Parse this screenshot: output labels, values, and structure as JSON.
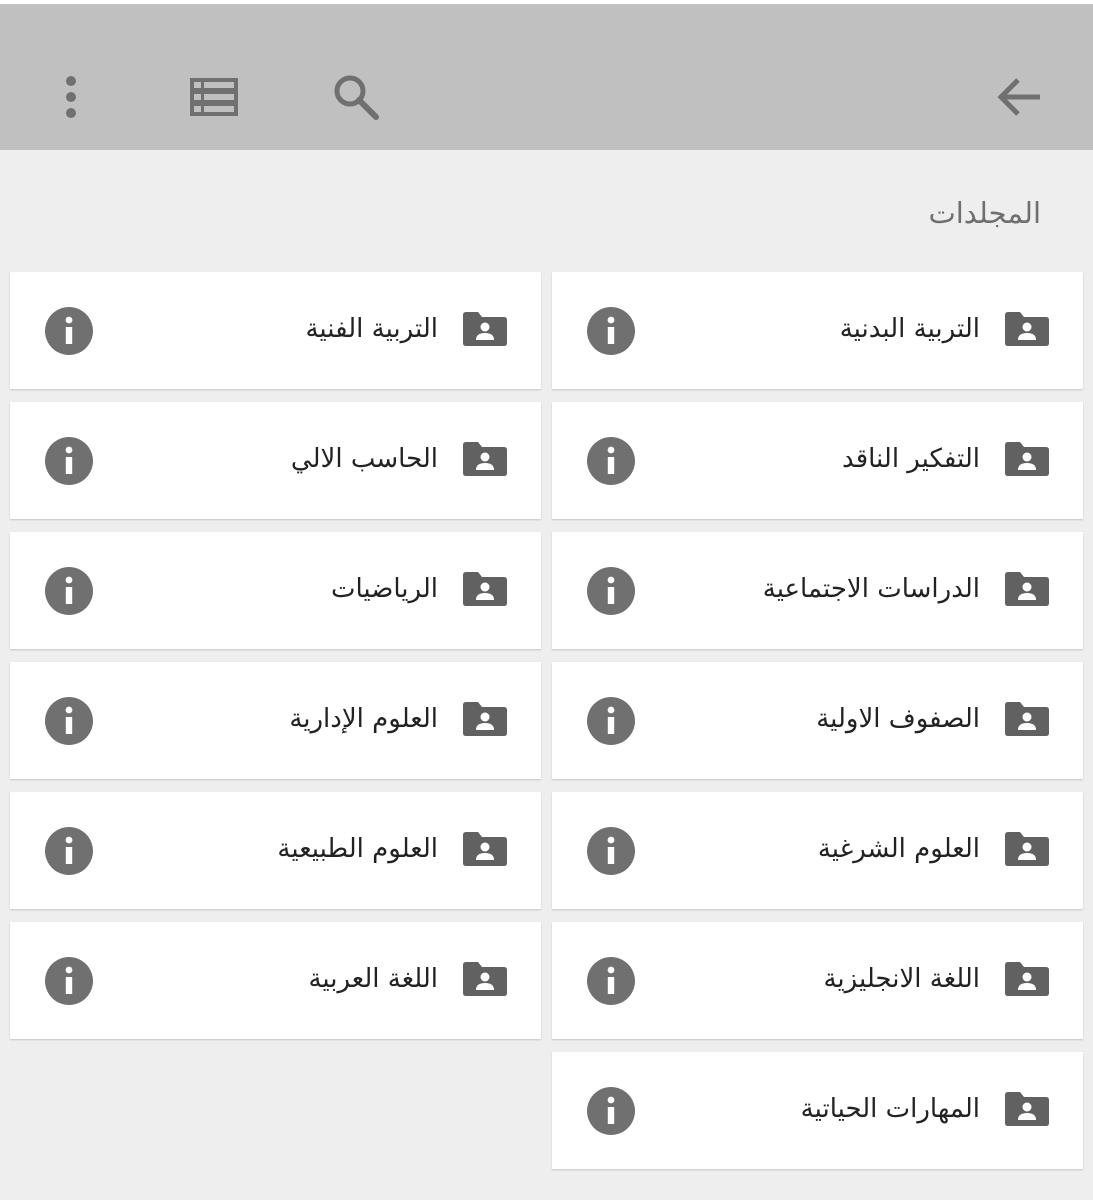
{
  "appbar": {
    "icons": {
      "back": "arrow-back-icon",
      "search": "search-icon",
      "view": "list-view-icon",
      "more": "more-vert-icon"
    }
  },
  "section": {
    "title": "المجلدات"
  },
  "folders": [
    {
      "label": "التربية البدنية"
    },
    {
      "label": "التربية الفنية"
    },
    {
      "label": "التفكير الناقد"
    },
    {
      "label": "الحاسب الالي"
    },
    {
      "label": "الدراسات الاجتماعية"
    },
    {
      "label": "الرياضيات"
    },
    {
      "label": "الصفوف الاولية"
    },
    {
      "label": "العلوم الإدارية"
    },
    {
      "label": "العلوم الشرغية"
    },
    {
      "label": "العلوم الطبيعية"
    },
    {
      "label": "اللغة الانجليزية"
    },
    {
      "label": "اللغة العربية"
    },
    {
      "label": "المهارات الحياتية"
    }
  ],
  "colors": {
    "appbar": "#c0c0c0",
    "background": "#eeeeee",
    "icon": "#707070",
    "folder": "#616161"
  }
}
